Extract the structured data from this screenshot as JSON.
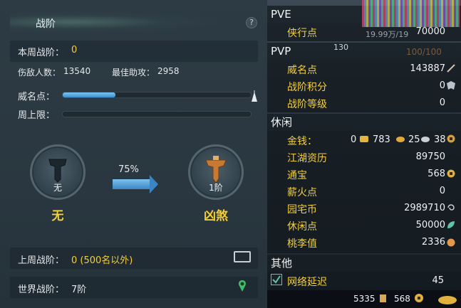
{
  "left": {
    "title": "战阶",
    "help": "?",
    "weekly_rank_label": "本周战阶：",
    "weekly_rank_value": "0",
    "kills_label": "伤敌人数：",
    "kills_value": "13540",
    "assist_label": "最佳助攻：",
    "assist_value": "2958",
    "prestige_label": "威名点：",
    "prestige_fill": 0.28,
    "weekly_cap_label": "周上限：",
    "weekly_cap_fill": 0,
    "progress_percent": "75%",
    "current_rank": {
      "level": "无",
      "name": "无"
    },
    "next_rank": {
      "level": "1阶",
      "name": "凶煞"
    },
    "last_week_label": "上周战阶：",
    "last_week_value": "0 (500名以外)",
    "world_rank_label": "世界战阶：",
    "world_rank_value": "7阶"
  },
  "right": {
    "pve": {
      "header": "PVE",
      "items": [
        {
          "label": "侠行点",
          "value": "70000"
        }
      ]
    },
    "pvp": {
      "header": "PVP",
      "items": [
        {
          "label": "威名点",
          "value": "143887"
        },
        {
          "label": "战阶积分",
          "value": "0"
        },
        {
          "label": "战阶等级",
          "value": "0"
        }
      ]
    },
    "leisure": {
      "header": "休闲",
      "money_label": "金钱：",
      "money": [
        "0",
        "783",
        "25",
        "38"
      ],
      "items": [
        {
          "label": "江湖资历",
          "value": "89750"
        },
        {
          "label": "通宝",
          "value": "568"
        },
        {
          "label": "薪火点",
          "value": "0"
        },
        {
          "label": "园宅币",
          "value": "2989710"
        },
        {
          "label": "休闲点",
          "value": "50000"
        },
        {
          "label": "桃李值",
          "value": "2336"
        }
      ]
    },
    "other": {
      "header": "其他",
      "items": [
        {
          "label": "网络延迟",
          "value": "45",
          "checked": true
        }
      ]
    },
    "bg_text": {
      "hp": "19.99万/19",
      "level": "130",
      "ratio": "100/100"
    },
    "bottom": {
      "a": "5335",
      "b": "568"
    }
  },
  "colors": {
    "accent": "#f3cf3a",
    "bar": "#3a8fd0"
  }
}
